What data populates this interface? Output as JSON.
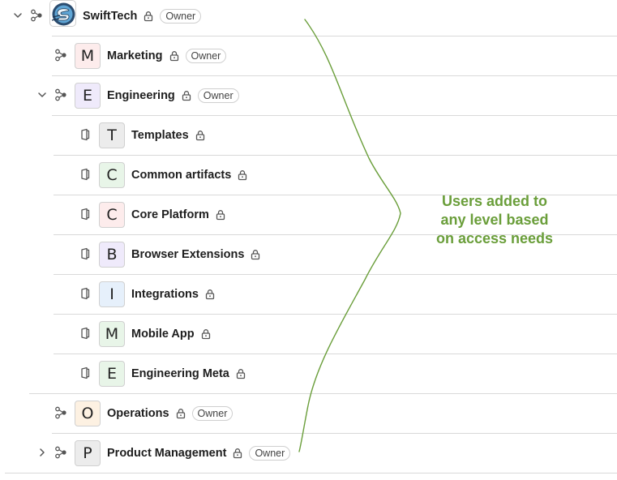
{
  "owner_label": "Owner",
  "org": {
    "name": "SwiftTech",
    "logo_icon": "swifttech-logo-icon"
  },
  "rows": [
    {
      "id": "swifttech",
      "avatar": "",
      "label": "SwiftTech",
      "badge": "Owner",
      "level": 0,
      "type": "group",
      "expander": "chevron-down"
    },
    {
      "id": "marketing",
      "avatar": "M",
      "label": "Marketing",
      "badge": "Owner",
      "level": 1,
      "type": "group",
      "expander": "",
      "avatar_bg": "#fdecec"
    },
    {
      "id": "engineering",
      "avatar": "E",
      "label": "Engineering",
      "badge": "Owner",
      "level": 1,
      "type": "group",
      "expander": "chevron-down",
      "avatar_bg": "#efeafb"
    },
    {
      "id": "templates",
      "avatar": "T",
      "label": "Templates",
      "badge": "",
      "level": 2,
      "type": "project",
      "avatar_bg": "#ececec"
    },
    {
      "id": "common-artifacts",
      "avatar": "C",
      "label": "Common artifacts",
      "badge": "",
      "level": 2,
      "type": "project",
      "avatar_bg": "#e8f5e8"
    },
    {
      "id": "core-platform",
      "avatar": "C",
      "label": "Core Platform",
      "badge": "",
      "level": 2,
      "type": "project",
      "avatar_bg": "#fdecec"
    },
    {
      "id": "browser-extensions",
      "avatar": "B",
      "label": "Browser Extensions",
      "badge": "",
      "level": 2,
      "type": "project",
      "avatar_bg": "#efeafb"
    },
    {
      "id": "integrations",
      "avatar": "I",
      "label": "Integrations",
      "badge": "",
      "level": 2,
      "type": "project",
      "avatar_bg": "#e6f0fb"
    },
    {
      "id": "mobile-app",
      "avatar": "M",
      "label": "Mobile App",
      "badge": "",
      "level": 2,
      "type": "project",
      "avatar_bg": "#e8f5e8"
    },
    {
      "id": "engineering-meta",
      "avatar": "E",
      "label": "Engineering Meta",
      "badge": "",
      "level": 2,
      "type": "project",
      "avatar_bg": "#e8f5e8"
    },
    {
      "id": "operations",
      "avatar": "O",
      "label": "Operations",
      "badge": "Owner",
      "level": 1,
      "type": "group",
      "expander": "",
      "avatar_bg": "#fdf1e2"
    },
    {
      "id": "product-management",
      "avatar": "P",
      "label": "Product Management",
      "badge": "Owner",
      "level": 1,
      "type": "group",
      "expander": "chevron-right",
      "avatar_bg": "#ececec"
    }
  ],
  "annotation": {
    "line1": "Users added to",
    "line2": "any level based",
    "line3": "on access needs",
    "color": "#6a9e3a"
  },
  "icons": {
    "group": "group-icon",
    "project": "project-icon",
    "lock": "lock-icon",
    "expand": "chevron-down-icon",
    "collapse": "chevron-right-icon"
  }
}
